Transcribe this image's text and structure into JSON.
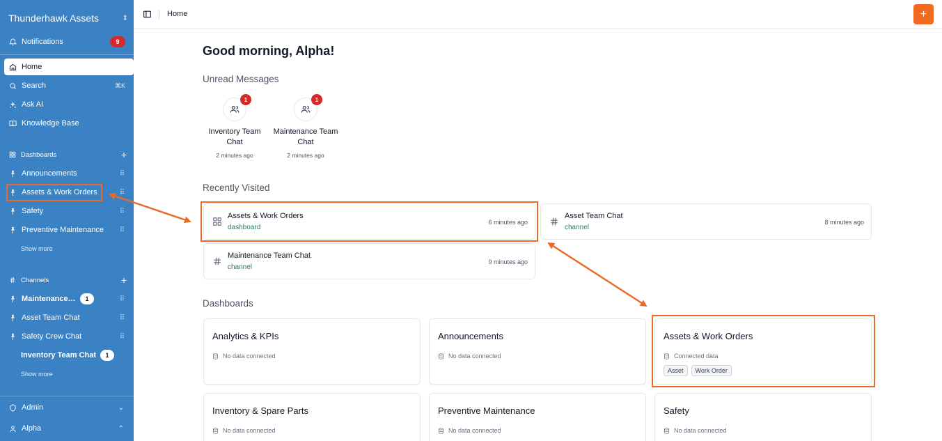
{
  "sidebar": {
    "workspace": "Thunderhawk Assets",
    "notifications": {
      "label": "Notifications",
      "count": "9"
    },
    "home": "Home",
    "search": {
      "label": "Search",
      "shortcut": "⌘K"
    },
    "ask_ai": "Ask AI",
    "knowledge_base": "Knowledge Base",
    "dashboards_heading": "Dashboards",
    "dashboards": [
      "Announcements",
      "Assets & Work Orders",
      "Safety",
      "Preventive Maintenance"
    ],
    "dashboards_show_more": "Show more",
    "channels_heading": "Channels",
    "channels": [
      {
        "label": "Maintenance ...",
        "badge": "1"
      },
      {
        "label": "Asset Team Chat"
      },
      {
        "label": "Safety Crew Chat"
      },
      {
        "label": "Inventory Team Chat",
        "badge": "1"
      }
    ],
    "channels_show_more": "Show more",
    "admin": "Admin",
    "user": "Alpha"
  },
  "topbar": {
    "breadcrumb": "Home",
    "add_label": "+"
  },
  "main": {
    "greeting": "Good morning, Alpha!",
    "unread_title": "Unread Messages",
    "unread": [
      {
        "name": "Inventory Team Chat",
        "badge": "1",
        "time": "2 minutes ago"
      },
      {
        "name": "Maintenance Team Chat",
        "badge": "1",
        "time": "2 minutes ago"
      }
    ],
    "recent_title": "Recently Visited",
    "recent": [
      {
        "title": "Assets & Work Orders",
        "type": "dashboard",
        "ago": "6 minutes ago"
      },
      {
        "title": "Asset Team Chat",
        "type": "channel",
        "ago": "8 minutes ago"
      },
      {
        "title": "Maintenance Team Chat",
        "type": "channel",
        "ago": "9 minutes ago"
      }
    ],
    "dashboards_title": "Dashboards",
    "dashboards": [
      {
        "title": "Analytics & KPIs",
        "status": "No data connected"
      },
      {
        "title": "Announcements",
        "status": "No data connected"
      },
      {
        "title": "Assets & Work Orders",
        "status": "Connected data",
        "tags": [
          "Asset",
          "Work Order"
        ]
      },
      {
        "title": "Inventory & Spare Parts",
        "status": "No data connected"
      },
      {
        "title": "Preventive Maintenance",
        "status": "No data connected"
      },
      {
        "title": "Safety",
        "status": "No data connected"
      }
    ]
  },
  "colors": {
    "sidebar": "#3b82c4",
    "accent": "#f06a22",
    "badge": "#d42a2a",
    "highlight": "#ea6a2a"
  }
}
